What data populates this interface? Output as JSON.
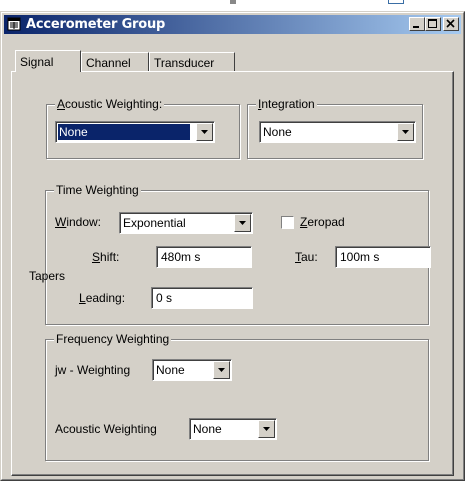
{
  "window": {
    "title": "Accerometer Group"
  },
  "tabs": [
    {
      "label": "Signal",
      "active": true
    },
    {
      "label": "Channel",
      "active": false
    },
    {
      "label": "Transducer",
      "active": false
    }
  ],
  "acoustic_weighting_group": {
    "legend_mnemonic": "A",
    "legend_rest": "coustic Weighting:",
    "value": "None"
  },
  "integration_group": {
    "legend_mnemonic": "I",
    "legend_rest": "ntegration",
    "value": "None"
  },
  "time_weighting_group": {
    "legend": "Time Weighting",
    "window_mnemonic": "W",
    "window_rest": "indow:",
    "window_value": "Exponential",
    "zeropad_mnemonic": "Z",
    "zeropad_rest": "eropad",
    "zeropad_checked": false,
    "shift_mnemonic": "S",
    "shift_rest": "hift:",
    "shift_value": "480m s",
    "tau_mnemonic": "T",
    "tau_rest": "au:",
    "tau_value": "100m s",
    "tapers_label": "Tapers",
    "leading_mnemonic": "L",
    "leading_rest": "eading:",
    "leading_value": "0 s"
  },
  "frequency_weighting_group": {
    "legend": "Frequency Weighting",
    "jw_label": "jw - Weighting",
    "jw_value": "None",
    "acoustic_label": "Acoustic Weighting",
    "acoustic_value": "None"
  },
  "colors": {
    "titlebar_start": "#0a246a",
    "titlebar_end": "#a6caf0",
    "face": "#d4d0c8",
    "selection": "#0a246a"
  }
}
